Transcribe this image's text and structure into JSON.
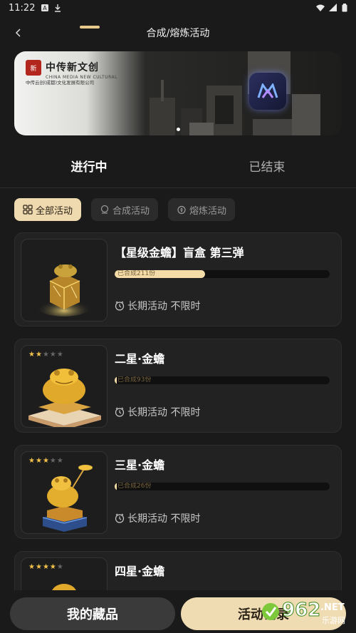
{
  "status_bar": {
    "time": "11:22",
    "icons_left": [
      "notification-a-icon",
      "download-icon"
    ],
    "icons_right": [
      "wifi-icon",
      "signal-icon",
      "battery-icon"
    ]
  },
  "header": {
    "title": "合成/熔炼活动",
    "back_icon": "chevron-left-icon"
  },
  "banner": {
    "brand_name": "中传新文创",
    "brand_en": "CHINA MEDIA NEW CULTURAL",
    "brand_company": "中传云创(成都)文化发展有限公司",
    "seal_text": "新",
    "page_count": 2,
    "active_page": 1
  },
  "tabs": [
    {
      "label": "进行中",
      "active": true
    },
    {
      "label": "已结束",
      "active": false
    }
  ],
  "filters": [
    {
      "label": "全部活动",
      "icon": "grid-icon",
      "active": true
    },
    {
      "label": "合成活动",
      "icon": "merge-icon",
      "active": false
    },
    {
      "label": "熔炼活动",
      "icon": "smelt-icon",
      "active": false
    }
  ],
  "activities": [
    {
      "title": "【星级金蟾】盲盒 第三弹",
      "progress_text": "已合成211份",
      "progress": 0.42,
      "duration": "长期活动 不限时",
      "stars": 0
    },
    {
      "title": "二星·金蟾",
      "progress_text": "已合成93份",
      "progress": 0.01,
      "duration": "长期活动 不限时",
      "stars": 2
    },
    {
      "title": "三星·金蟾",
      "progress_text": "已合成26份",
      "progress": 0.01,
      "duration": "长期活动 不限时",
      "stars": 3
    },
    {
      "title": "四星·金蟾",
      "progress_text": "",
      "progress": 0,
      "duration": "",
      "stars": 4
    }
  ],
  "bottom": {
    "collection_label": "我的藏品",
    "records_label": "活动记录"
  },
  "watermark": {
    "text": "962",
    "suffix": ".NET",
    "sub": "乐游网"
  },
  "colors": {
    "accent": "#efd9ae",
    "progress_fill": "#f3dca8",
    "background": "#1a1a1a",
    "card": "#222222"
  }
}
